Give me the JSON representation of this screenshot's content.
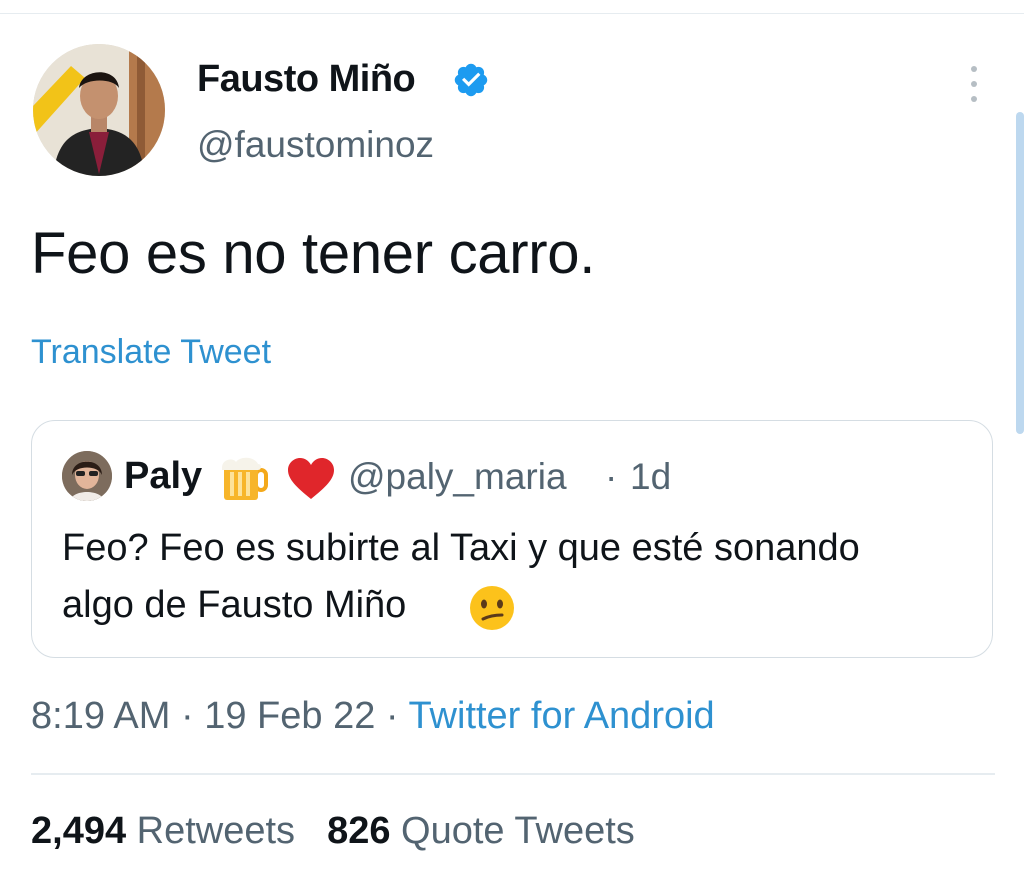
{
  "author": {
    "name": "Fausto Miño",
    "handle": "@faustominoz",
    "verified": true
  },
  "tweet": {
    "text": "Feo es no tener carro.",
    "translate_label": "Translate Tweet"
  },
  "quoted": {
    "name": "Paly",
    "name_emojis": [
      "beer-mug-icon",
      "red-heart-icon"
    ],
    "handle": "@paly_maria",
    "separator": "·",
    "time": "1d",
    "text_line1": "Feo? Feo es subirte al Taxi y que esté sonando",
    "text_line2": "algo de Fausto Miño",
    "trailing_emoji": "confused-face-icon"
  },
  "meta": {
    "time": "8:19 AM",
    "sep1": " · ",
    "date": "19 Feb 22",
    "sep2": " · ",
    "source": "Twitter for Android"
  },
  "stats": {
    "retweets_count": "2,494",
    "retweets_label": "Retweets",
    "quotes_count": "826",
    "quotes_label": "Quote Tweets"
  },
  "colors": {
    "link": "#2e91d0",
    "secondary_text": "#536471",
    "verified": "#1d9bf0",
    "heart": "#e0262b"
  }
}
